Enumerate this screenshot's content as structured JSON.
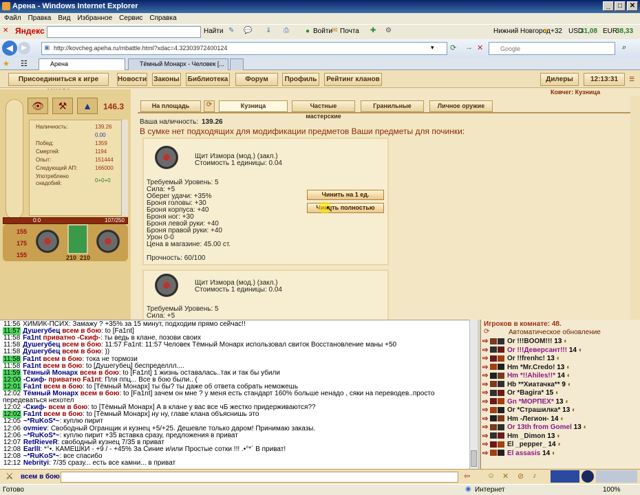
{
  "window": {
    "title": "Арена - Windows Internet Explorer"
  },
  "menu": [
    "Файл",
    "Правка",
    "Вид",
    "Избранное",
    "Сервис",
    "Справка"
  ],
  "ytoolbar": {
    "logo": "Яндекс",
    "find": "Найти",
    "login": "Войти",
    "mail": "Почта",
    "city": "Нижний Новгород",
    "temp": "+32",
    "usd_label": "USD",
    "usd": "31,08",
    "eur_label": "EUR",
    "eur": "38,33"
  },
  "address": {
    "url": "http://kovcheg.apeha.ru/mbattle.html?xdac=4.32303972400124",
    "search_placeholder": "Google"
  },
  "tabs": [
    "Арена",
    "Тёмный Монарх - Человек [..."
  ],
  "topnav": {
    "rejoin": "Присоединиться к игре заново",
    "news": "Новости",
    "laws": "Законы",
    "library": "Библиотека",
    "forum": "Форум",
    "profile": "Профиль",
    "clans": "Рейтинг кланов",
    "dealers": "Дилеры",
    "time": "12:13:31",
    "location": "Ковчег: Кузница"
  },
  "char": {
    "level": "146.3",
    "stats": [
      {
        "label": "Наличность:",
        "value": "139.26"
      },
      {
        "label": "",
        "value": "0.00"
      },
      {
        "label": "Побед:",
        "value": "1359"
      },
      {
        "label": "Смертей:",
        "value": "1194"
      },
      {
        "label": "Опыт:",
        "value": "151444"
      },
      {
        "label": "Следующий АП:",
        "value": "166000"
      },
      {
        "label": "Употреблено",
        "value": ""
      },
      {
        "label": "снадобий:",
        "value": "0+0+0"
      }
    ],
    "bar_left": "0:0",
    "bar_right": "107/250",
    "hp1": "155",
    "hp2": "175",
    "hp3": "155",
    "slot1": "210",
    "slot2": "210"
  },
  "shoptabs": {
    "square": "На площадь",
    "forge": "Кузница",
    "private": "Частные мастерские",
    "cut": "Гранильные",
    "personal": "Личное оружие"
  },
  "shop": {
    "cash_label": "Ваша наличность:",
    "cash": "139.26",
    "notice": "В сумке нет подходящих для модификации предметов Ваши предметы для починки:"
  },
  "item1": {
    "name": "Щит Измора (мод.) (закл.)",
    "cost": "Стоимость 1 единицы: 0.04",
    "lines": [
      "Требуемый Уровень: 5",
      "Сила: +5",
      "Оберег удачи: +35%",
      "Броня головы: +30",
      "Броня корпуса: +40",
      "Броня ног: +30",
      "Броня левой руки: +40",
      "Броня правой руки: +40",
      "Урон 0-0",
      "Цена в магазине: 45.00 ст."
    ],
    "durability": "Прочность: 60/100",
    "repair_one": "Чинить на 1 ед.",
    "repair_full": "Чинить полностью"
  },
  "item2": {
    "name": "Щит Измора (мод.) (закл.)",
    "cost": "Стоимость 1 единицы: 0.04",
    "lines": [
      "Требуемый Уровень: 5",
      "Сила: +5"
    ]
  },
  "chat": [
    {
      "t": "11:56",
      "hl": false,
      "text": "ХИМИК-ПСИХ: Замажу ? +35% за 15 минут, подходим прямо сейчас!!"
    },
    {
      "t": "11:57",
      "hl": true,
      "nick": "Душегубец",
      "to": "всем в бою",
      "text": ": to [Fa1nt]"
    },
    {
      "t": "11:58",
      "hl": false,
      "nick": "Fa1nt",
      "to": "приватно -Скиф-",
      "text": ": ты ведь в клане, позови своих"
    },
    {
      "t": "11:58",
      "hl": false,
      "nick": "Душегубец",
      "to": "всем в бою",
      "text": ": 11:57 Fa1nt: 11:57 Человек Тёмный Монарх использовал свиток Восстановление маны +50"
    },
    {
      "t": "11:58",
      "hl": false,
      "nick": "Душегубец",
      "to": "всем в бою",
      "text": ": ))"
    },
    {
      "t": "11:58",
      "hl": true,
      "nick": "Fa1nt",
      "to": "всем в бою",
      "text": ": тока не тормози"
    },
    {
      "t": "11:58",
      "hl": false,
      "nick": "Fa1nt",
      "to": "всем в бою",
      "text": ": to [Душегубец] беспределлл...."
    },
    {
      "t": "11:59",
      "hl": true,
      "nick": "Тёмный Монарх",
      "to": "всем в бою",
      "text": ": to [Fa1nt] 1 жизнь оставалась..так и так бы убили"
    },
    {
      "t": "12:00",
      "hl": true,
      "nick": "-Скиф-",
      "to": "приватно Fa1nt",
      "text": ": Пля ппц... Все в бою были.. ("
    },
    {
      "t": "12:01",
      "hl": true,
      "nick": "Fa1nt",
      "to": "всем в бою",
      "text": ": to [Тёмный Монарх] ты бы? ты даже об ответа собрать неможешь"
    },
    {
      "t": "12:02",
      "hl": false,
      "nick": "Тёмный Монарх",
      "to": "всем в бою",
      "text": ": to [Fa1nt] зачем он мне ? у меня есть стандарт 160% больше ненадо , сяки на переводев..просто"
    },
    {
      "t": "",
      "hl": false,
      "text": "передеваться нехотел"
    },
    {
      "t": "12:02",
      "hl": false,
      "nick": "-Скиф-",
      "to": "всем в бою",
      "text": ": to [Тёмный Монарх] А в клане у вас все чБ жестко придерживаются??"
    },
    {
      "t": "12:02",
      "hl": true,
      "nick": "Fa1nt",
      "to": "всем в бою",
      "text": ": to [Тёмный Монарх] ну ну, главе клана объяснишь это"
    },
    {
      "t": "12:05",
      "hl": false,
      "nick": "~*RuKoS*~",
      "text": ": куплю пирит"
    },
    {
      "t": "12:06",
      "hl": false,
      "nick": "ovmiev",
      "text": ": Свободный Огранщик и кузнец +5/+25. Дешевле только даром! Принимаю заказы."
    },
    {
      "t": "12:06",
      "hl": false,
      "nick": "~*RuKoS*~",
      "text": ": куплю пирит +35 вставка сразу, предложения в приват"
    },
    {
      "t": "12:07",
      "hl": false,
      "nick": "RetRieveR",
      "text": ": свободный кузнец 7/35 в приват"
    },
    {
      "t": "12:08",
      "hl": false,
      "nick": "EarllI",
      "text": ": *°•. КАМЕШКИ - +9 / - +45% За Синие и/или Простые сотки !!! .•°*´ В приват!"
    },
    {
      "t": "12:08",
      "hl": false,
      "nick": "~*RuKoS*~",
      "text": ": все спасибо"
    },
    {
      "t": "12:12",
      "hl": false,
      "nick": "Nebrityi",
      "text": ": 7/35 сразу... есть все камни... в приват"
    }
  ],
  "players": {
    "header": "Игроков в комнате: 48.",
    "auto": "Автоматическое обновление",
    "list": [
      {
        "name": "Or !!!BOOM!!!",
        "lvl": "13"
      },
      {
        "name": "Or !!!Деверсант!!!",
        "lvl": "14"
      },
      {
        "name": "Or !!frenhc!",
        "lvl": "13"
      },
      {
        "name": "Hm *Mr.Credo!",
        "lvl": "13"
      },
      {
        "name": "Hm *!!Ahiles!!*",
        "lvl": "14"
      },
      {
        "name": "Hb **Хиатачка**",
        "lvl": "9"
      },
      {
        "name": "Or *Bagira*",
        "lvl": "15"
      },
      {
        "name": "Gn *МОРПЕХ*",
        "lvl": "13"
      },
      {
        "name": "Or *Страшилка*",
        "lvl": "13"
      },
      {
        "name": "Hm -Легион-",
        "lvl": "14"
      },
      {
        "name": "Or 13th from Gomel",
        "lvl": "13"
      },
      {
        "name": "Hm _Dimon",
        "lvl": "13"
      },
      {
        "name": "El _pepper_",
        "lvl": "14"
      },
      {
        "name": "El assasis",
        "lvl": "14"
      }
    ]
  },
  "input": {
    "target": "всем в бою"
  },
  "status": {
    "left": "Готово",
    "zone": "Интернет",
    "zoom": "100%"
  },
  "colors": {
    "title": "#0a246a",
    "game_bg": "#f3e6c4",
    "accent": "#a03010",
    "highlight": "#4fd860"
  }
}
